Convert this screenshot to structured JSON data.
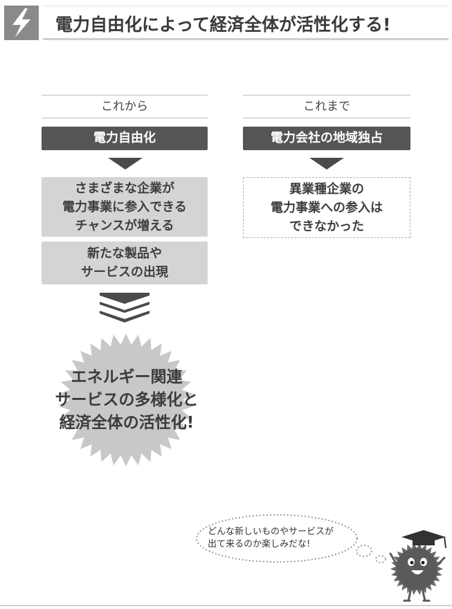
{
  "header": {
    "title": "電力自由化によって経済全体が活性化する!",
    "icon": "lightning-bolt-icon"
  },
  "columns": {
    "future": {
      "heading": "これから",
      "label": "電力自由化",
      "effects": [
        [
          "さまざまな企業が",
          "電力事業に参入できる",
          "チャンスが増える"
        ],
        [
          "新たな製品や",
          "サービスの出現"
        ]
      ]
    },
    "past": {
      "heading": "これまで",
      "label": "電力会社の地域独占",
      "effect": [
        "異業種企業の",
        "電力事業への参入は",
        "できなかった"
      ]
    }
  },
  "result": {
    "lines": [
      "エネルギー関連",
      "サービスの多様化と",
      "経済全体の活性化!"
    ]
  },
  "mascot": {
    "speech": [
      "どんな新しいものやサービスが",
      "出て来るのか楽しみだな!"
    ]
  },
  "colors": {
    "dark_box": "#555555",
    "light_box": "#d4d4d4",
    "burst": "#c8c8c8",
    "arrow": "#4a4a4a"
  }
}
